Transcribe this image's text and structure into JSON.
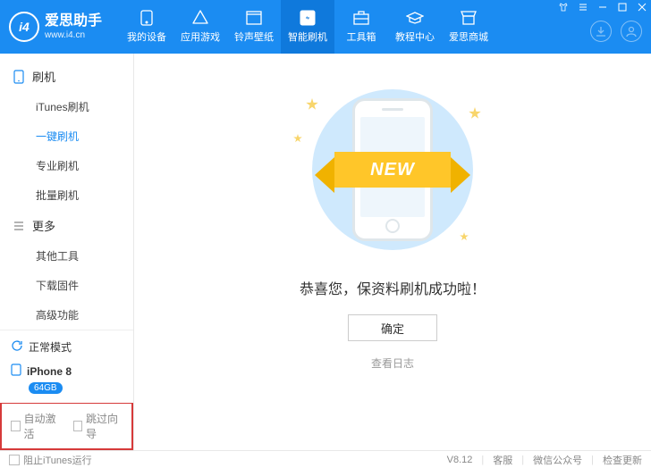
{
  "brand": {
    "name": "爱思助手",
    "url": "www.i4.cn",
    "logo_text": "i4"
  },
  "nav": [
    {
      "label": "我的设备"
    },
    {
      "label": "应用游戏"
    },
    {
      "label": "铃声壁纸"
    },
    {
      "label": "智能刷机"
    },
    {
      "label": "工具箱"
    },
    {
      "label": "教程中心"
    },
    {
      "label": "爱思商城"
    }
  ],
  "sidebar": {
    "group1_title": "刷机",
    "group1_items": [
      "iTunes刷机",
      "一键刷机",
      "专业刷机",
      "批量刷机"
    ],
    "group2_title": "更多",
    "group2_items": [
      "其他工具",
      "下载固件",
      "高级功能"
    ],
    "mode": "正常模式",
    "device_name": "iPhone 8",
    "device_badge": "64GB",
    "auto_activate": "自动激活",
    "skip_guide": "跳过向导"
  },
  "main": {
    "ribbon": "NEW",
    "success_text": "恭喜您，保资料刷机成功啦！",
    "ok_btn": "确定",
    "log_link": "查看日志"
  },
  "footer": {
    "block_itunes": "阻止iTunes运行",
    "version": "V8.12",
    "support": "客服",
    "wechat": "微信公众号",
    "check_update": "检查更新"
  }
}
